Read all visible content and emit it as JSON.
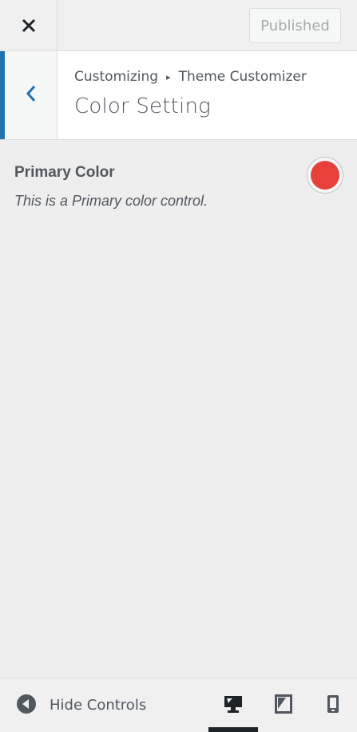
{
  "header": {
    "close_icon": "close-icon",
    "publish_label": "Published"
  },
  "section": {
    "back_icon": "chevron-left-icon",
    "breadcrumb_root": "Customizing",
    "breadcrumb_separator": "▸",
    "breadcrumb_current": "Theme Customizer",
    "title": "Color Setting"
  },
  "control": {
    "title": "Primary Color",
    "description": "This is a Primary color control.",
    "color_value": "#e8413b"
  },
  "footer": {
    "hide_controls_label": "Hide Controls",
    "devices": [
      {
        "name": "desktop",
        "icon": "desktop-icon",
        "active": true
      },
      {
        "name": "tablet",
        "icon": "tablet-icon",
        "active": false
      },
      {
        "name": "mobile",
        "icon": "mobile-icon",
        "active": false
      }
    ]
  },
  "colors": {
    "accent": "#2271b1",
    "primary_swatch": "#e8413b",
    "active_device": "#1d2327"
  }
}
